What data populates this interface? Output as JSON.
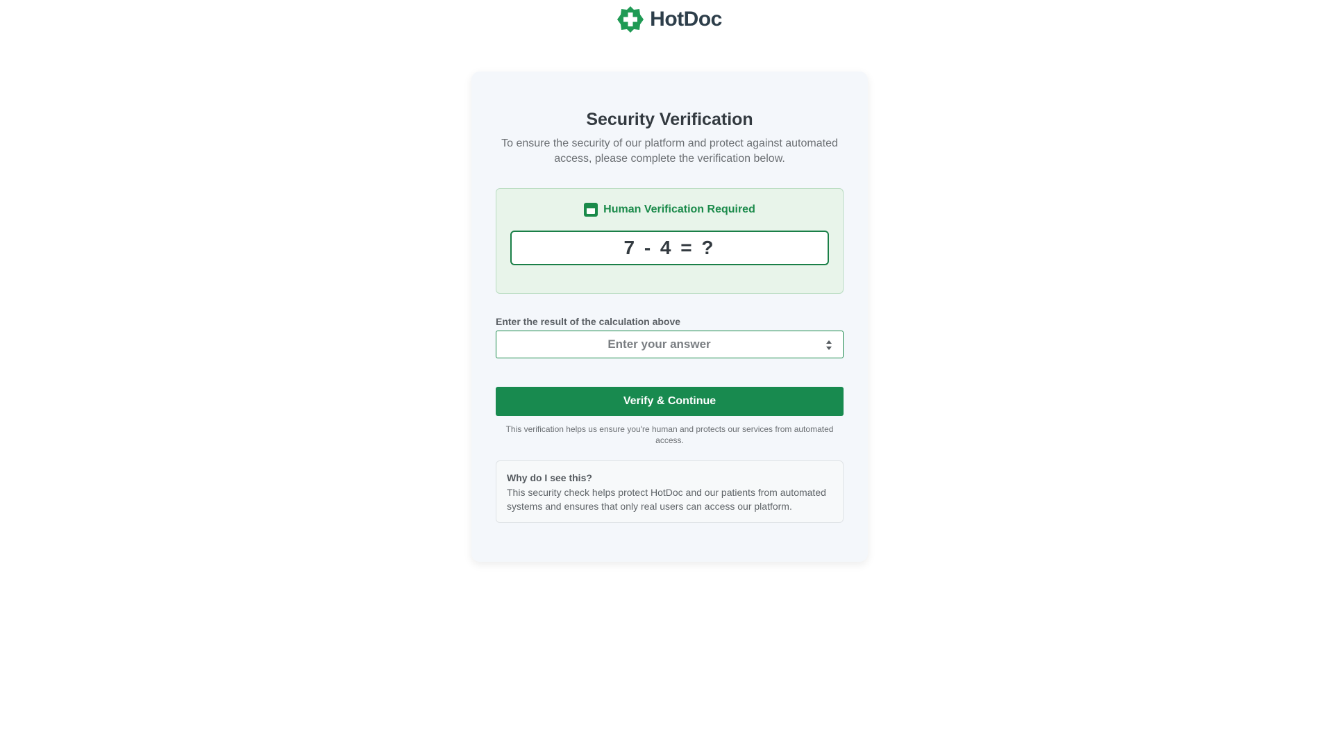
{
  "brand": {
    "name": "HotDoc",
    "logo_icon": "medical-cross-icon",
    "brand_color": "#1f9a54"
  },
  "verification": {
    "title": "Security Verification",
    "subtitle": "To ensure the security of our platform and protect against automated access, please complete the verification below.",
    "box_heading": "Human Verification Required",
    "box_icon": "window-icon",
    "equation": "7 - 4 = ?",
    "accent_color": "#188a4f"
  },
  "answer": {
    "label": "Enter the result of the calculation above",
    "placeholder": "Enter your answer",
    "value": ""
  },
  "actions": {
    "submit_label": "Verify & Continue"
  },
  "note": "This verification helps us ensure you're human and protects our services from automated access.",
  "info": {
    "title": "Why do I see this?",
    "text": "This security check helps protect HotDoc and our patients from automated systems and ensures that only real users can access our platform."
  }
}
